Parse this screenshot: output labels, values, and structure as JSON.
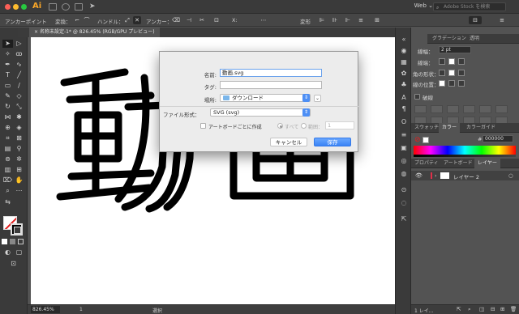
{
  "app": {
    "logo": "Ai",
    "workspace": "Web ⌄",
    "stock_search_placeholder": "Adobe Stock を検索"
  },
  "control_bar": {
    "selection_label": "アンカーポイント",
    "convert_label": "変換：",
    "handle_label": "ハンドル：",
    "anchor_label": "アンカー：",
    "transform_label": "変形"
  },
  "document_tab": {
    "title": "名称未設定-1* @ 826.45% (RGB/GPU プレビュー)",
    "close": "×"
  },
  "artwork": {
    "text": "動画",
    "stroke_color": "#000000"
  },
  "status_bar": {
    "zoom": "826.45%",
    "page": "1",
    "mode": "選択"
  },
  "properties_panel": {
    "tabs": [
      "",
      "グラデーション",
      "透明"
    ],
    "stroke_weight_label": "線幅：",
    "stroke_weight_value": "2 pt",
    "cap_label": "線端：",
    "corner_label": "角の形状：",
    "align_label": "線の位置：",
    "dash_label": "破線"
  },
  "color_panel": {
    "tabs": [
      "スウォッチ",
      "カラー",
      "カラーガイド"
    ],
    "hex_symbol": "#",
    "hex_value": "000000"
  },
  "layers_panel": {
    "tabs": [
      "プロパティ",
      "アートボード",
      "レイヤー"
    ],
    "layer_name": "レイヤー 2",
    "footer_count": "1 レイ..."
  },
  "save_dialog": {
    "name_label": "名前:",
    "name_value": "動画.svg",
    "tags_label": "タグ:",
    "tags_value": "",
    "location_label": "場所:",
    "location_value": "ダウンロード",
    "format_label": "ファイル形式：",
    "format_value": "SVG (svg)",
    "per_artboard_label": "アートボードごとに作成",
    "all_label": "すべて",
    "range_label": "範囲：",
    "range_value": "1",
    "cancel_label": "キャンセル",
    "save_label": "保存"
  },
  "colors": {
    "accent": "#3a83f6",
    "layer_color": "#e0304a",
    "fill_none_slash": "#e21e1e"
  }
}
